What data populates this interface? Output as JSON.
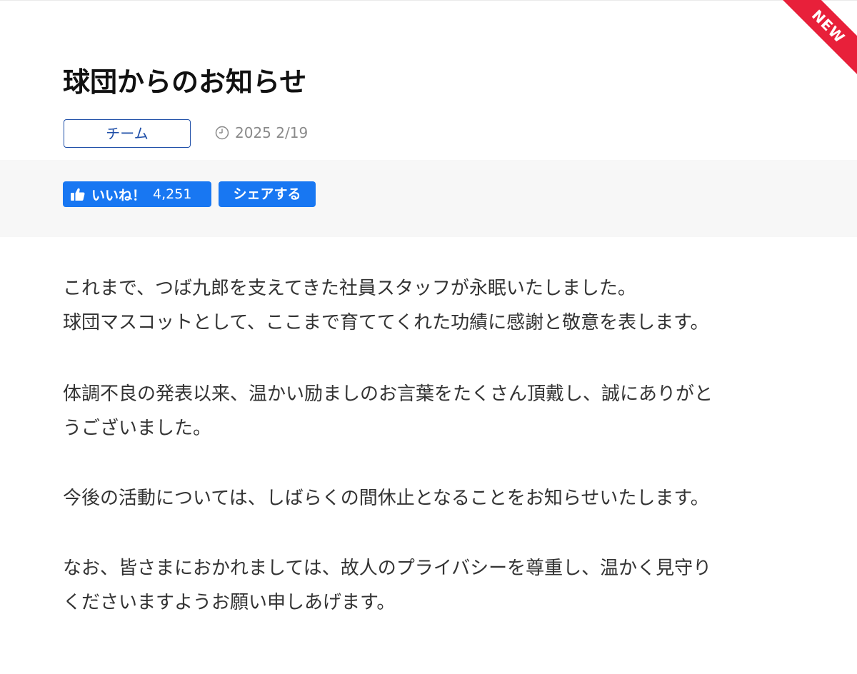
{
  "badge": {
    "label": "NEW",
    "color": "#e8203a"
  },
  "article": {
    "title": "球団からのお知らせ",
    "category": "チーム",
    "date": "2025 2/19",
    "clock_icon": "clock-icon",
    "accent_color": "#1f4fa8"
  },
  "share": {
    "like_label": "いいね！",
    "like_count": "4,251",
    "share_label": "シェアする",
    "button_color": "#1877f2",
    "like_icon": "thumbs-up-icon"
  },
  "body": {
    "p1": [
      "これまで、つば九郎を支えてきた社員スタッフが永眠いたしました。",
      "球団マスコットとして、ここまで育ててくれた功績に感謝と敬意を表します。"
    ],
    "p2": [
      "体調不良の発表以来、温かい励ましのお言葉をたくさん頂戴し、誠にありがと",
      "うございました。"
    ],
    "p3": [
      "今後の活動については、しばらくの間休止となることをお知らせいたします。"
    ],
    "p4": [
      "なお、皆さまにおかれましては、故人のプライバシーを尊重し、温かく見守り",
      "くださいますようお願い申しあげます。"
    ]
  }
}
